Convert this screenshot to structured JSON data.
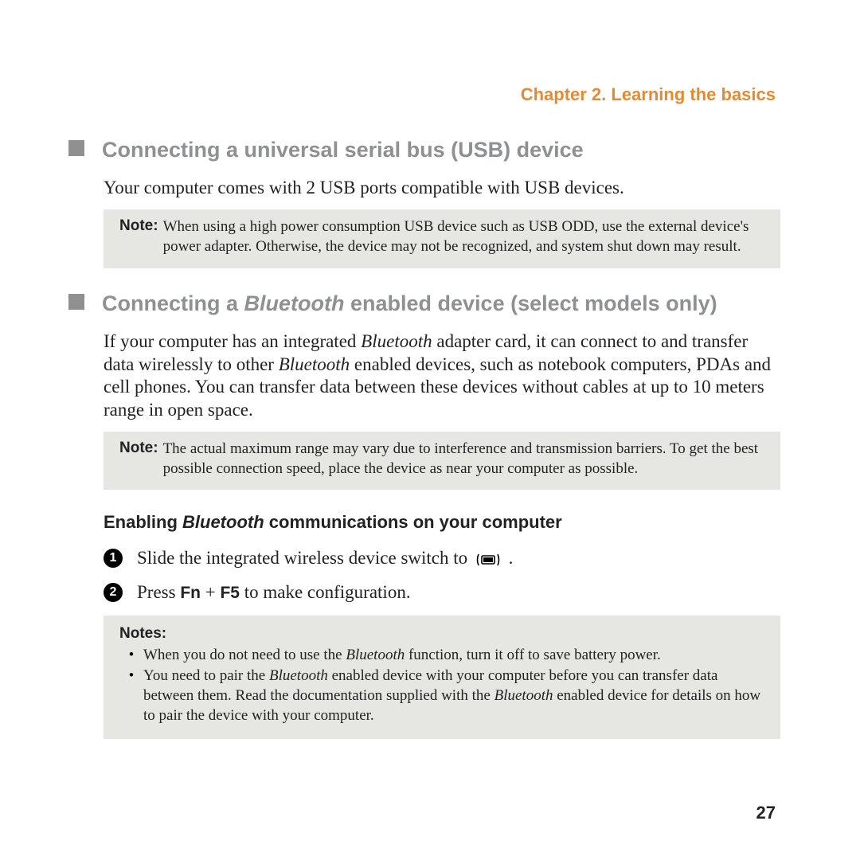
{
  "header": {
    "chapter": "Chapter 2. Learning the basics"
  },
  "section1": {
    "title": "Connecting a universal serial bus (USB) device",
    "body": "Your computer comes with 2 USB ports compatible with USB devices.",
    "note_label": "Note:",
    "note_text": "When using a high power consumption USB device such as USB ODD, use the external device's power adapter. Otherwise, the device may not be recognized, and system shut down may result."
  },
  "section2": {
    "title_prefix": "Connecting a ",
    "title_italic": "Bluetooth",
    "title_suffix": " enabled device (select models only)",
    "body_parts": [
      "If your computer has an integrated ",
      "Bluetooth",
      " adapter card, it can connect to and transfer data wirelessly to other ",
      "Bluetooth",
      " enabled devices, such as notebook computers, PDAs and cell phones. You can transfer data between these devices without cables at up to 10 meters range in open space."
    ],
    "note_label": "Note:",
    "note_text": "The actual maximum range may vary due to interference and transmission barriers. To get the best possible connection speed, place the device as near your computer as possible."
  },
  "subsection": {
    "heading_prefix": "Enabling ",
    "heading_italic": "Bluetooth",
    "heading_suffix": " communications on your computer",
    "step1_num": "1",
    "step1_text": "Slide the integrated wireless device switch to ",
    "step1_suffix": " .",
    "step2_num": "2",
    "step2_prefix": "Press ",
    "step2_key1": "Fn",
    "step2_plus": " + ",
    "step2_key2": "F5",
    "step2_suffix": " to make configuration."
  },
  "notes_list": {
    "label": "Notes:",
    "items": [
      {
        "parts": [
          "When you do not need to use the ",
          "Bluetooth",
          " function, turn it off to save battery power."
        ]
      },
      {
        "parts": [
          "You need to pair the ",
          "Bluetooth",
          " enabled device with your computer before you can transfer data between them. Read the documentation supplied with the ",
          "Bluetooth",
          " enabled device for details on how to pair the device with your computer."
        ]
      }
    ]
  },
  "page_number": "27"
}
